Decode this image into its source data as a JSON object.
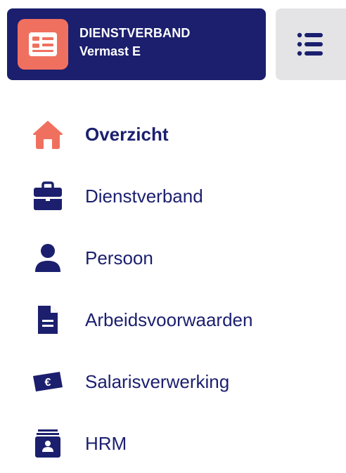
{
  "header": {
    "title": "DIENSTVERBAND",
    "subtitle": "Vermast E",
    "icon": "id-card-icon",
    "icon_bg_color": "#f0705f",
    "bg_color": "#1b1f6e"
  },
  "menu_toggle": {
    "icon": "list-icon"
  },
  "nav": {
    "items": [
      {
        "label": "Overzicht",
        "icon": "home-icon",
        "active": true,
        "icon_color": "#f0705f"
      },
      {
        "label": "Dienstverband",
        "icon": "briefcase-icon",
        "active": false
      },
      {
        "label": "Persoon",
        "icon": "person-icon",
        "active": false
      },
      {
        "label": "Arbeidsvoorwaarden",
        "icon": "document-icon",
        "active": false
      },
      {
        "label": "Salarisverwerking",
        "icon": "euro-banknote-icon",
        "active": false
      },
      {
        "label": "HRM",
        "icon": "id-stack-icon",
        "active": false
      }
    ]
  }
}
